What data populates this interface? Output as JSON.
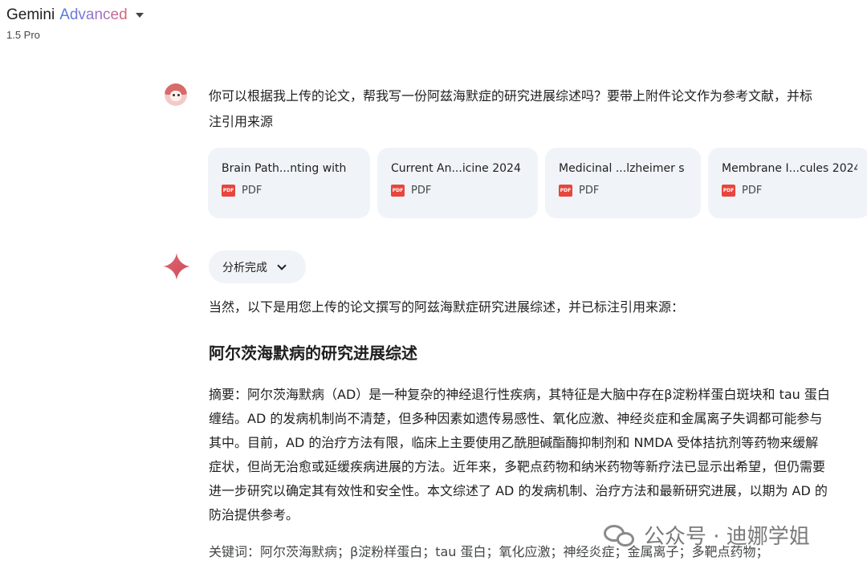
{
  "header": {
    "brand": "Gemini",
    "brand_tier": "Advanced",
    "model": "1.5 Pro"
  },
  "user_prompt": "你可以根据我上传的论文，帮我写一份阿兹海默症的研究进展综述吗？要带上附件论文作为参考文献，并标注引用来源",
  "attachments": [
    {
      "name": "Brain Path...nting with",
      "type": "PDF"
    },
    {
      "name": "Current An...icine 2024",
      "type": "PDF"
    },
    {
      "name": "Medicinal ...lzheimer s",
      "type": "PDF"
    },
    {
      "name": "Membrane I...cules 2024",
      "type": "PDF"
    }
  ],
  "response": {
    "analysis_label": "分析完成",
    "intro": "当然，以下是用您上传的论文撰写的阿兹海默症研究进展综述，并已标注引用来源：",
    "title": "阿尔茨海默病的研究进展综述",
    "abstract": "摘要：阿尔茨海默病（AD）是一种复杂的神经退行性疾病，其特征是大脑中存在β淀粉样蛋白斑块和 tau 蛋白缠结。AD 的发病机制尚不清楚，但多种因素如遗传易感性、氧化应激、神经炎症和金属离子失调都可能参与其中。目前，AD 的治疗方法有限，临床上主要使用乙酰胆碱酯酶抑制剂和 NMDA 受体拮抗剂等药物来缓解症状，但尚无治愈或延缓疾病进展的方法。近年来，多靶点药物和纳米药物等新疗法已显示出希望，但仍需要进一步研究以确定其有效性和安全性。本文综述了 AD 的发病机制、治疗方法和最新研究进展，以期为 AD 的防治提供参考。",
    "keywords": "关键词：阿尔茨海默病；β淀粉样蛋白；tau 蛋白；氧化应激；神经炎症；金属离子；多靶点药物；"
  },
  "watermark": "公众号 · 迪娜学姐",
  "colors": {
    "chip_bg": "#f0f4f9",
    "pdf_red": "#e8453c",
    "gemini_blue": "#4b7be5",
    "gemini_pink": "#d96570"
  }
}
